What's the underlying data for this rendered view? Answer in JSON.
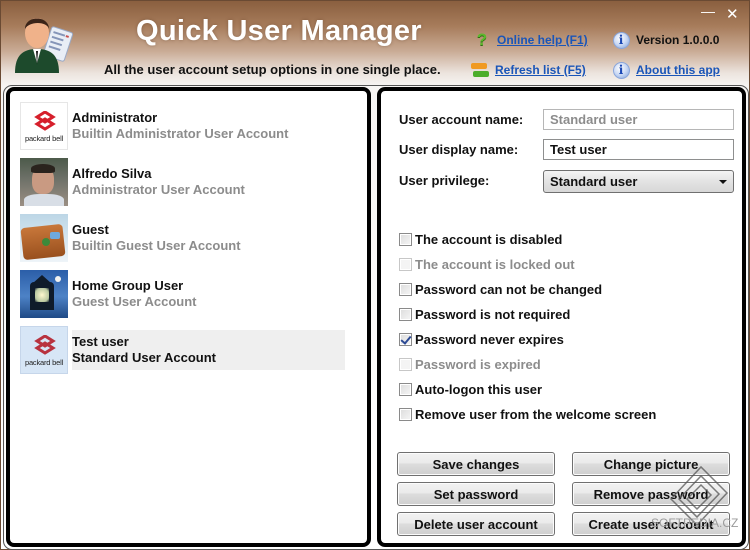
{
  "window": {
    "title": "Quick User Manager",
    "subtitle": "All the user account setup options in one single place.",
    "controls": {
      "minimize": "—",
      "close": "✕"
    }
  },
  "header_links": {
    "online_help": {
      "label": "Online help (F1)",
      "icon": "help-question-icon"
    },
    "refresh_list": {
      "label": "Refresh list (F5)",
      "icon": "refresh-icon"
    },
    "version": {
      "label": "Version 1.0.0.0",
      "icon": "info-icon"
    },
    "about": {
      "label": "About this app",
      "icon": "info-icon"
    }
  },
  "users": [
    {
      "name": "Administrator",
      "description": "Builtin Administrator User Account",
      "avatar": "packard-bell-logo",
      "selected": false
    },
    {
      "name": "Alfredo Silva",
      "description": "Administrator User Account",
      "avatar": "photo",
      "selected": false
    },
    {
      "name": "Guest",
      "description": "Builtin Guest User Account",
      "avatar": "suitcase",
      "selected": false
    },
    {
      "name": "Home Group User",
      "description": "Guest User Account",
      "avatar": "lighthouse",
      "selected": false
    },
    {
      "name": "Test user",
      "description": "Standard User Account",
      "avatar": "packard-bell-logo",
      "selected": true
    }
  ],
  "avatar_text": {
    "brand": "packard bell"
  },
  "form": {
    "account_name_label": "User account name:",
    "account_name_value": "Standard user",
    "display_name_label": "User display name:",
    "display_name_value": "Test user",
    "privilege_label": "User privilege:",
    "privilege_value": "Standard user"
  },
  "options": [
    {
      "label": "The account is disabled",
      "checked": false,
      "enabled": true
    },
    {
      "label": "The account is locked out",
      "checked": false,
      "enabled": false
    },
    {
      "label": "Password can not be changed",
      "checked": false,
      "enabled": true
    },
    {
      "label": "Password is not required",
      "checked": false,
      "enabled": true
    },
    {
      "label": "Password never expires",
      "checked": true,
      "enabled": true
    },
    {
      "label": "Password is expired",
      "checked": false,
      "enabled": false
    },
    {
      "label": "Auto-logon this user",
      "checked": false,
      "enabled": true
    },
    {
      "label": "Remove user from the welcome screen",
      "checked": false,
      "enabled": true
    }
  ],
  "buttons": {
    "save_changes": "Save changes",
    "change_picture": "Change picture",
    "set_password": "Set password",
    "remove_password": "Remove password",
    "delete_user_account": "Delete user account",
    "create_user_account": "Create user account"
  },
  "watermark": "SOFTPEDIA.CZ"
}
